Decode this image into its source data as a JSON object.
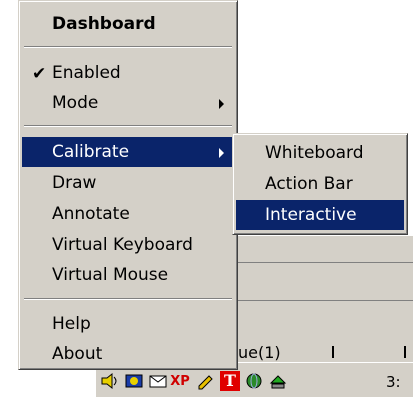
{
  "menu": {
    "header": "Dashboard",
    "items": [
      {
        "label": "Enabled",
        "checked": true
      },
      {
        "label": "Mode",
        "submenu": true
      },
      {
        "label": "Calibrate",
        "submenu": true,
        "selected": true
      },
      {
        "label": "Draw"
      },
      {
        "label": "Annotate"
      },
      {
        "label": "Virtual Keyboard"
      },
      {
        "label": "Virtual Mouse"
      },
      {
        "label": "Help"
      },
      {
        "label": "About"
      }
    ]
  },
  "submenu": {
    "items": [
      {
        "label": "Whiteboard"
      },
      {
        "label": "Action Bar"
      },
      {
        "label": "Interactive",
        "selected": true
      }
    ]
  },
  "background": {
    "partial_text": "ue(1)"
  },
  "taskbar": {
    "tray_icons": [
      "speaker-icon",
      "network-icon",
      "mail-icon",
      "xp-icon",
      "pencil-icon",
      "t-icon",
      "globe-icon",
      "green-arrow-icon"
    ],
    "clock": "3:"
  },
  "colors": {
    "menu_bg": "#d4d0c8",
    "highlight": "#0a246a",
    "highlight_text": "#ffffff"
  }
}
